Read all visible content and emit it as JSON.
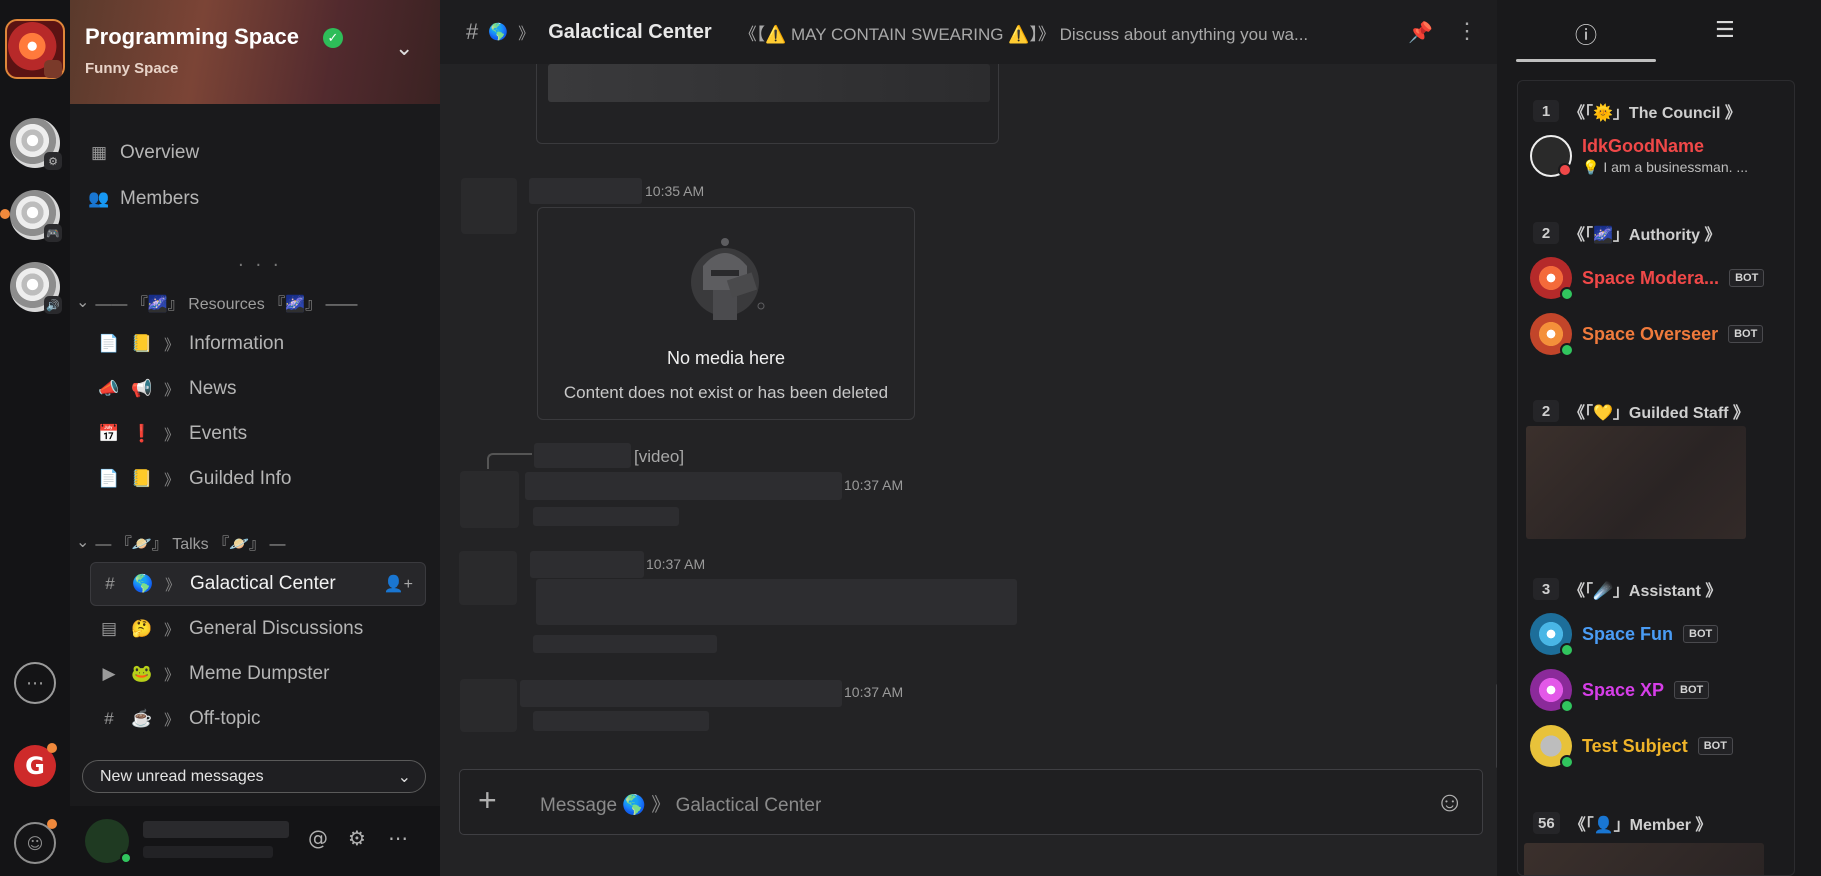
{
  "server": {
    "name": "Programming Space",
    "subtitle": "Funny Space"
  },
  "nav": {
    "overview": "Overview",
    "members": "Members",
    "more_dots": ". . ."
  },
  "categories": {
    "resources": "—— 『🌌』 Resources 『🌌』 ——",
    "talks": "— 『🪐』 Talks 『🪐』 —"
  },
  "channels_resources": [
    {
      "emoji": "📒",
      "name": "Information"
    },
    {
      "emoji": "📢",
      "name": "News"
    },
    {
      "emoji": "❗",
      "name": "Events"
    },
    {
      "emoji": "📒",
      "name": "Guilded Info"
    }
  ],
  "channels_talks": [
    {
      "emoji": "🌎",
      "name": "Galactical Center"
    },
    {
      "emoji": "🤔",
      "name": "General Discussions"
    },
    {
      "emoji": "🐸",
      "name": "Meme Dumpster"
    },
    {
      "emoji": "☕",
      "name": "Off-topic"
    }
  ],
  "sep": "》",
  "unread_label": "New unread messages",
  "header": {
    "emoji": "🌎",
    "channel": "Galactical Center",
    "topic": "《【⚠️ MAY CONTAIN SWEARING ⚠️】》 Discuss about anything you wa..."
  },
  "messages": {
    "time_1": "10:35 AM",
    "nomedia_title": "No media here",
    "nomedia_sub": "Content does not exist or has been deleted",
    "video_label": "[video]",
    "time_2": "10:37 AM",
    "time_3": "10:37 AM",
    "time_4": "10:37 AM"
  },
  "composer": {
    "placeholder": "Message 🌎 》 Galactical Center"
  },
  "groups": [
    {
      "count": "1",
      "name": "《「🌞」The Council 》"
    },
    {
      "count": "2",
      "name": "《「🌌」Authority 》"
    },
    {
      "count": "2",
      "name": "《「💛」Guilded Staff 》"
    },
    {
      "count": "3",
      "name": "《「☄️」Assistant 》"
    },
    {
      "count": "56",
      "name": "《「👤」Member 》"
    }
  ],
  "members": {
    "idk": {
      "name": "IdkGoodName",
      "status": "💡 I am a businessman. ...",
      "color": "#f04848"
    },
    "mod": {
      "name": "Space Modera...",
      "color": "#f04848"
    },
    "overseer": {
      "name": "Space Overseer",
      "color": "#ef7a3c"
    },
    "fun": {
      "name": "Space Fun",
      "color": "#4a9cf5"
    },
    "xp": {
      "name": "Space XP",
      "color": "#d63ee8"
    },
    "test": {
      "name": "Test Subject",
      "color": "#f0b429"
    }
  },
  "bot_tag": "BOT"
}
